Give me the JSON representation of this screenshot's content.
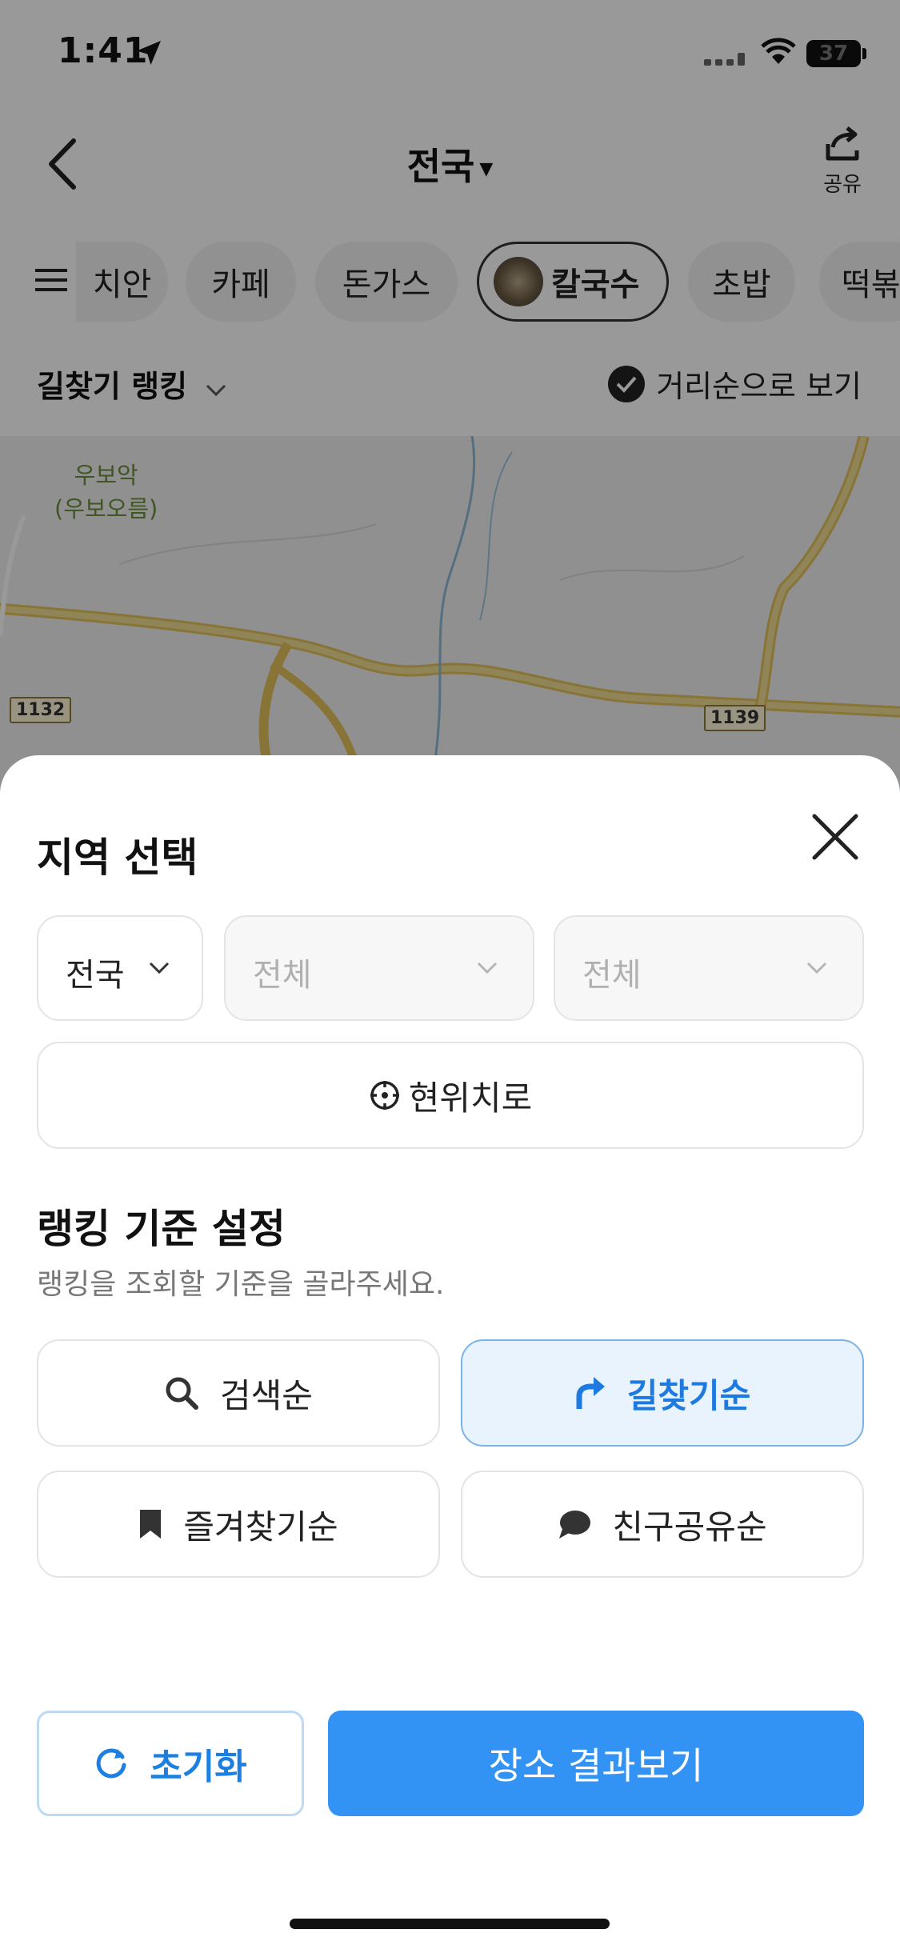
{
  "status": {
    "time": "1:41",
    "battery": "37"
  },
  "header": {
    "title": "전국",
    "share_label": "공유"
  },
  "categories": [
    "치안",
    "카페",
    "돈가스",
    "칼국수",
    "초밥",
    "떡볶"
  ],
  "active_category": "칼국수",
  "sortbar": {
    "ranking_label": "길찾기 랭킹",
    "distance_label": "거리순으로 보기"
  },
  "map": {
    "place_name": "우보악",
    "place_alias": "(우보오름)",
    "road_1": "1132",
    "road_2": "1139"
  },
  "sheet": {
    "title": "지역 선택",
    "region": {
      "province": "전국",
      "city": "전체",
      "district": "전체"
    },
    "current_location_label": "현위치로",
    "ranking_title": "랭킹 기준 설정",
    "ranking_subtitle": "랭킹을 조회할 기준을 골라주세요.",
    "options": [
      {
        "label": "검색순",
        "icon": "search-icon",
        "selected": false
      },
      {
        "label": "길찾기순",
        "icon": "turn-arrow-icon",
        "selected": true
      },
      {
        "label": "즐겨찾기순",
        "icon": "bookmark-icon",
        "selected": false
      },
      {
        "label": "친구공유순",
        "icon": "chat-bubble-icon",
        "selected": false
      }
    ],
    "reset_label": "초기화",
    "submit_label": "장소 결과보기"
  },
  "colors": {
    "accent": "#3293f5",
    "selected_bg": "#e8f3fd",
    "map_road": "#e9c662"
  }
}
